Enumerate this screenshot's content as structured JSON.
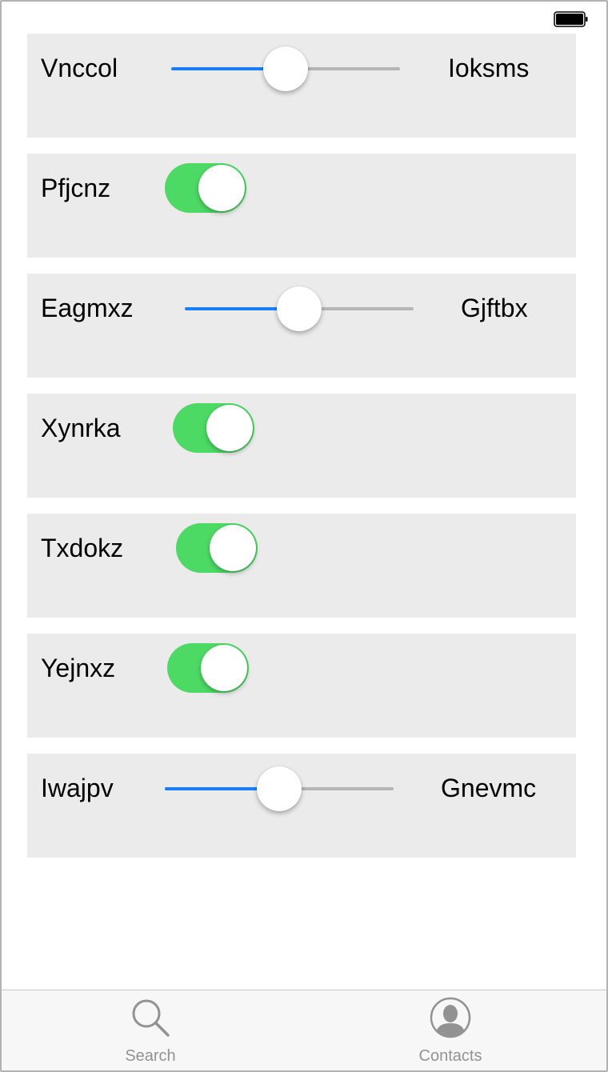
{
  "status_bar": {
    "battery_icon": "battery-icon"
  },
  "rows": [
    {
      "type": "slider",
      "left_label": "Vnccol",
      "right_label": "Ioksms",
      "value": 0.5
    },
    {
      "type": "toggle",
      "label": "Pfjcnz",
      "on": true
    },
    {
      "type": "slider",
      "left_label": "Eagmxz",
      "right_label": "Gjftbx",
      "value": 0.5
    },
    {
      "type": "toggle",
      "label": "Xynrka",
      "on": true
    },
    {
      "type": "toggle",
      "label": "Txdokz",
      "on": true
    },
    {
      "type": "toggle",
      "label": "Yejnxz",
      "on": true
    },
    {
      "type": "slider",
      "left_label": "Iwajpv",
      "right_label": "Gnevmc",
      "value": 0.5
    }
  ],
  "tabbar": {
    "search": {
      "label": "Search",
      "icon": "search-icon"
    },
    "contacts": {
      "label": "Contacts",
      "icon": "contacts-icon"
    }
  },
  "colors": {
    "slider_fill": "#1a7ef6",
    "slider_track": "#b5b5b5",
    "toggle_on": "#4cd964",
    "row_background": "#ebebeb",
    "tab_inactive": "#929292"
  }
}
